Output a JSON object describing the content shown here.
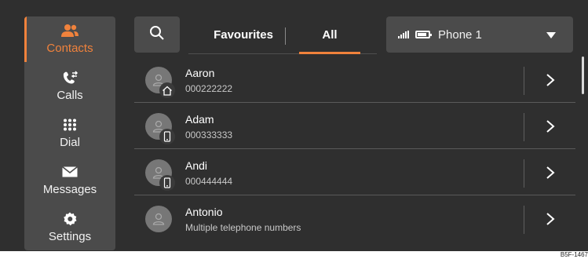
{
  "sidebar": {
    "items": [
      {
        "label": "Contacts",
        "icon": "contacts-icon",
        "active": true
      },
      {
        "label": "Calls",
        "icon": "calls-icon",
        "active": false
      },
      {
        "label": "Dial",
        "icon": "dialpad-icon",
        "active": false
      },
      {
        "label": "Messages",
        "icon": "envelope-icon",
        "active": false
      },
      {
        "label": "Settings",
        "icon": "gear-icon",
        "active": false
      }
    ]
  },
  "toolbar": {
    "search_icon": "search-icon",
    "tabs": [
      {
        "label": "Favourites",
        "active": false
      },
      {
        "label": "All",
        "active": true
      }
    ],
    "phone_selector": {
      "value": "Phone 1",
      "signal_icon": "signal-icon",
      "battery_icon": "battery-icon",
      "dropdown_icon": "caret-down-icon"
    }
  },
  "contacts": [
    {
      "name": "Aaron",
      "detail": "000222222",
      "badge": "home-icon"
    },
    {
      "name": "Adam",
      "detail": "000333333",
      "badge": "mobile-icon"
    },
    {
      "name": "Andi",
      "detail": "000444444",
      "badge": "mobile-icon"
    },
    {
      "name": "Antonio",
      "detail": "Multiple telephone numbers",
      "badge": ""
    }
  ],
  "reference_code": "B5F-1467",
  "colors": {
    "accent": "#f0823c",
    "background": "#2f2f2f",
    "panel": "#4b4b4b"
  }
}
